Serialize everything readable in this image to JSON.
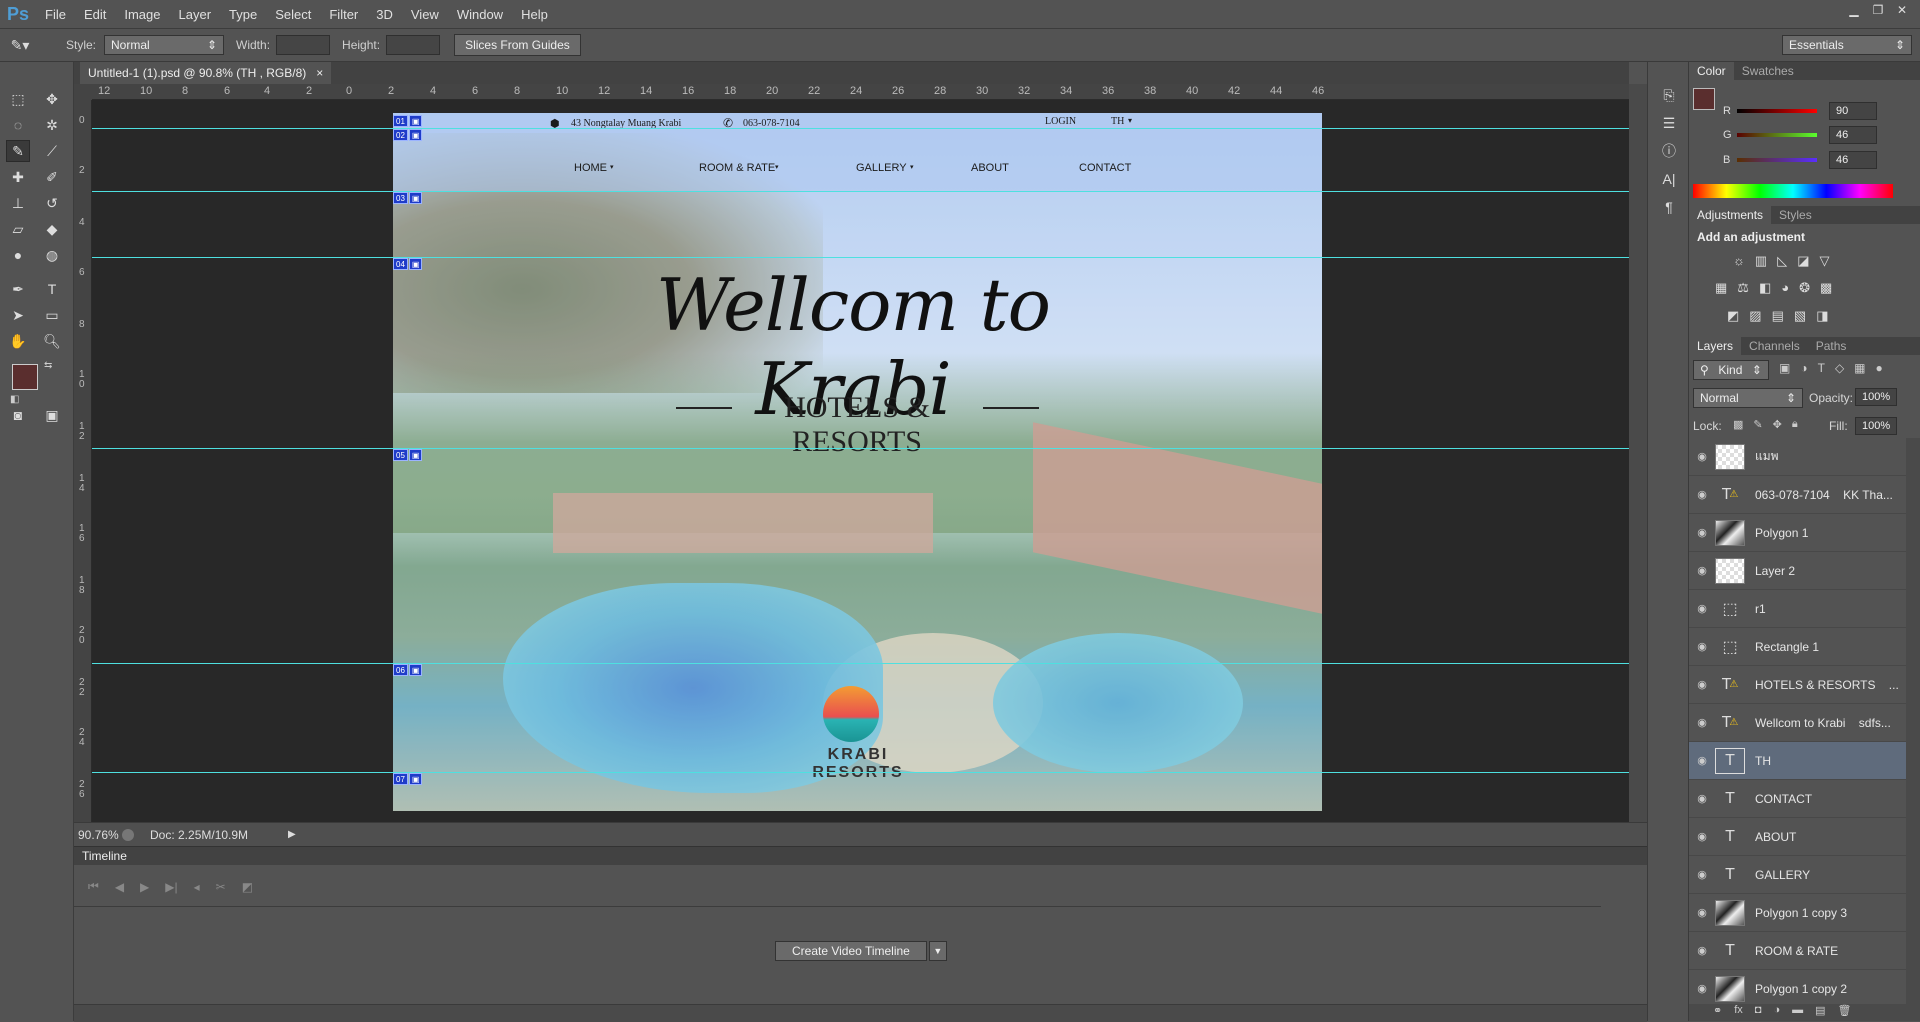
{
  "app": {
    "logo": "Ps",
    "menu": [
      "File",
      "Edit",
      "Image",
      "Layer",
      "Type",
      "Select",
      "Filter",
      "3D",
      "View",
      "Window",
      "Help"
    ]
  },
  "options_bar": {
    "style_label": "Style:",
    "style_value": "Normal",
    "width_label": "Width:",
    "height_label": "Height:",
    "slices_button": "Slices From Guides",
    "workspace": "Essentials"
  },
  "document": {
    "tab_title": "Untitled-1 (1).psd @ 90.8% (TH , RGB/8)",
    "close": "×",
    "zoom": "90.76%",
    "doc_info": "Doc: 2.25M/10.9M",
    "ruler_top": [
      "12",
      "10",
      "8",
      "6",
      "4",
      "2",
      "0",
      "2",
      "4",
      "6",
      "8",
      "10",
      "12",
      "14",
      "16",
      "18",
      "20",
      "22",
      "24",
      "26",
      "28",
      "30",
      "32",
      "34",
      "36",
      "38",
      "40",
      "42",
      "44",
      "46"
    ],
    "ruler_left": [
      "0",
      "2",
      "4",
      "6",
      "8",
      "1 0",
      "1 2",
      "1 4",
      "1 6",
      "1 8",
      "2 0",
      "2 2",
      "2 4",
      "2 6"
    ],
    "slices": [
      "01",
      "02",
      "03",
      "04",
      "05",
      "06",
      "07"
    ]
  },
  "website": {
    "address": "43 Nongtalay Muang Krabi",
    "phone": "063-078-7104",
    "login": "LOGIN",
    "lang": "TH",
    "nav": [
      "HOME",
      "ROOM & RATE",
      "GALLERY",
      "ABOUT",
      "CONTACT"
    ],
    "headline": "Wellcom to Krabi",
    "subheadline": "HOTELS & RESORTS",
    "logo_text": "KRABI RESORTS"
  },
  "timeline": {
    "title": "Timeline",
    "create_button": "Create Video Timeline"
  },
  "color_panel": {
    "tabs": [
      "Color",
      "Swatches"
    ],
    "R": "90",
    "G": "46",
    "B": "46",
    "foreground": "#5a2e2e",
    "background": "#c8f0f0"
  },
  "adjustments_panel": {
    "tabs": [
      "Adjustments",
      "Styles"
    ],
    "heading": "Add an adjustment"
  },
  "layers_panel": {
    "tabs": [
      "Layers",
      "Channels",
      "Paths"
    ],
    "filter": "Kind",
    "blend_mode": "Normal",
    "opacity_label": "Opacity:",
    "opacity": "100%",
    "lock_label": "Lock:",
    "fill_label": "Fill:",
    "fill": "100%",
    "layers": [
      {
        "name": "แมพ",
        "thumb": "checker"
      },
      {
        "name": "063-078-7104    KK Tha...",
        "thumb": "text-warn"
      },
      {
        "name": "Polygon 1",
        "thumb": "img"
      },
      {
        "name": "Layer 2",
        "thumb": "checker"
      },
      {
        "name": "r1",
        "thumb": "frame"
      },
      {
        "name": "Rectangle 1",
        "thumb": "frame"
      },
      {
        "name": "HOTELS & RESORTS    ...",
        "thumb": "text-warn"
      },
      {
        "name": "Wellcom to Krabi    sdfs...",
        "thumb": "text-warn"
      },
      {
        "name": "TH",
        "thumb": "text",
        "selected": true
      },
      {
        "name": "CONTACT",
        "thumb": "text"
      },
      {
        "name": "ABOUT",
        "thumb": "text"
      },
      {
        "name": "GALLERY",
        "thumb": "text"
      },
      {
        "name": "Polygon 1 copy 3",
        "thumb": "img"
      },
      {
        "name": "ROOM & RATE",
        "thumb": "text"
      },
      {
        "name": "Polygon 1 copy 2",
        "thumb": "img"
      }
    ]
  }
}
